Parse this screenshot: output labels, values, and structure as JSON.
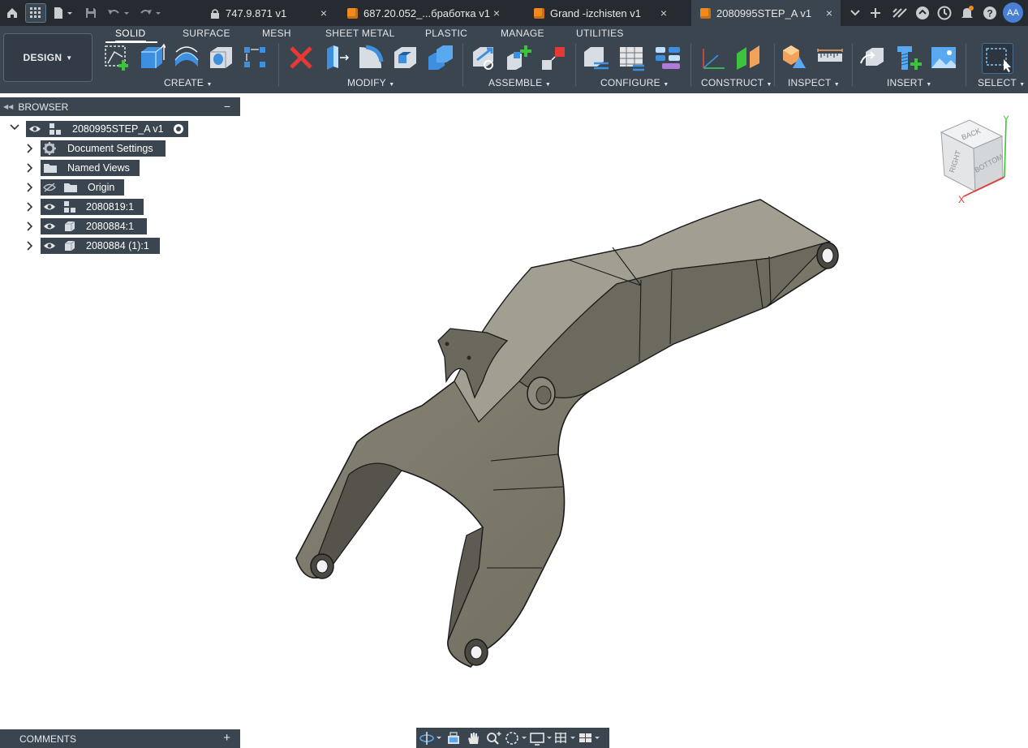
{
  "tabs": [
    {
      "label": "747.9.871 v1",
      "active": false,
      "has_icon": false
    },
    {
      "label": "687.20.052_...бработка v1",
      "active": false,
      "has_icon": true
    },
    {
      "label": "Grand -izchisten v1",
      "active": false,
      "has_icon": true
    },
    {
      "label": "2080995STEP_A v1",
      "active": true,
      "has_icon": true
    }
  ],
  "tab_close_glyph": "×",
  "user_initials": "AA",
  "workspace": {
    "label": "DESIGN"
  },
  "ribbon_tabs": [
    "SOLID",
    "SURFACE",
    "MESH",
    "SHEET METAL",
    "PLASTIC",
    "MANAGE",
    "UTILITIES"
  ],
  "ribbon_groups": [
    "CREATE",
    "MODIFY",
    "ASSEMBLE",
    "CONFIGURE",
    "CONSTRUCT",
    "INSPECT",
    "INSERT",
    "SELECT"
  ],
  "browser": {
    "title": "BROWSER",
    "root": {
      "label": "2080995STEP_A v1"
    },
    "items": [
      {
        "label": "Document Settings",
        "icon": "gear-icon"
      },
      {
        "label": "Named Views",
        "icon": "folder-icon"
      },
      {
        "label": "Origin",
        "icon": "folder-icon",
        "hidden": true
      },
      {
        "label": "2080819:1",
        "icon": "component-icon"
      },
      {
        "label": "2080884:1",
        "icon": "body-icon"
      },
      {
        "label": "2080884 (1):1",
        "icon": "body-icon"
      }
    ]
  },
  "comments": {
    "title": "COMMENTS"
  },
  "viewcube": {
    "faces": [
      "BACK",
      "RIGHT",
      "BOTTOM"
    ],
    "axes": [
      "Y",
      "X"
    ]
  },
  "colors": {
    "ribbon": "#3b4550",
    "tabbar": "#262b31",
    "accent_tab_icon": "#f28a1e",
    "model": "#7e7a6c"
  }
}
